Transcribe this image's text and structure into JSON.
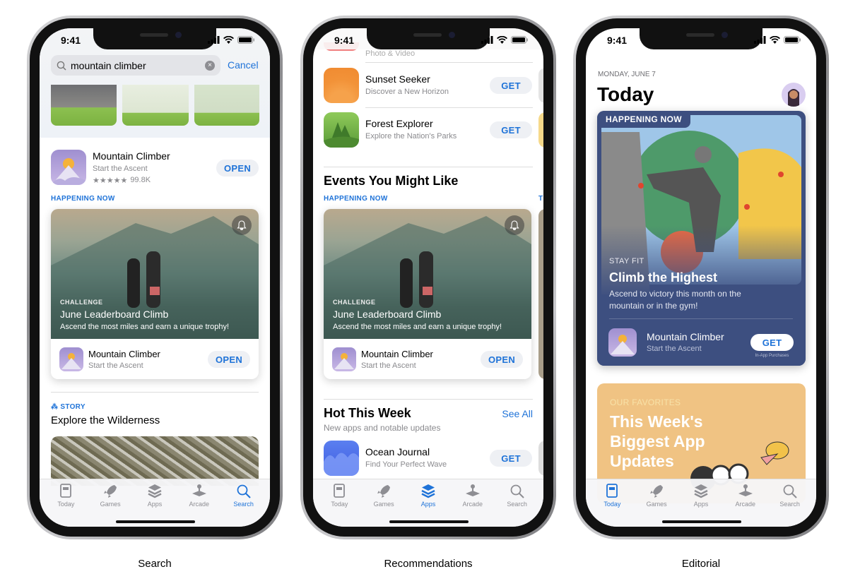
{
  "status_time": "9:41",
  "captions": [
    "Search",
    "Recommendations",
    "Editorial"
  ],
  "colors": {
    "accent": "#1f73d8",
    "editorial_card": "#3d4f80",
    "favorites_card": "#f0c383"
  },
  "tabs": [
    {
      "label": "Today",
      "icon": "today-icon"
    },
    {
      "label": "Games",
      "icon": "rocket-icon"
    },
    {
      "label": "Apps",
      "icon": "layers-icon"
    },
    {
      "label": "Arcade",
      "icon": "joystick-icon"
    },
    {
      "label": "Search",
      "icon": "search-icon"
    }
  ],
  "search_screen": {
    "active_tab": "Search",
    "search_value": "mountain climber",
    "cancel": "Cancel",
    "result": {
      "title": "Mountain Climber",
      "subtitle": "Start the Ascent",
      "rating": 4.5,
      "ratings_count": "99.8K",
      "button": "OPEN"
    },
    "happening_now": "HAPPENING NOW",
    "event": {
      "kicker": "CHALLENGE",
      "title": "June Leaderboard Climb",
      "desc": "Ascend the most miles and earn a unique trophy!",
      "app_title": "Mountain Climber",
      "app_subtitle": "Start the Ascent",
      "button": "OPEN"
    },
    "story": {
      "kicker": "STORY",
      "title": "Explore the Wilderness"
    }
  },
  "recs_screen": {
    "active_tab": "Apps",
    "partial_row": "Photo & Video",
    "apps": [
      {
        "title": "Sunset Seeker",
        "subtitle": "Discover a New Horizon",
        "button": "GET"
      },
      {
        "title": "Forest Explorer",
        "subtitle": "Explore the Nation's Parks",
        "button": "GET"
      }
    ],
    "events_heading": "Events You Might Like",
    "happening_now": "HAPPENING NOW",
    "event": {
      "kicker": "CHALLENGE",
      "title": "June Leaderboard Climb",
      "desc": "Ascend the most miles and earn a unique trophy!",
      "app_title": "Mountain Climber",
      "app_subtitle": "Start the Ascent",
      "button": "OPEN"
    },
    "hot": {
      "title": "Hot This Week",
      "see_all": "See All",
      "subtitle": "New apps and notable updates"
    },
    "hot_app": {
      "title": "Ocean Journal",
      "subtitle": "Find Your Perfect Wave",
      "button": "GET"
    }
  },
  "today_screen": {
    "active_tab": "Today",
    "date": "MONDAY, JUNE 7",
    "title": "Today",
    "card": {
      "badge": "HAPPENING NOW",
      "kicker": "STAY FIT",
      "title": "Climb the Highest",
      "desc": "Ascend to victory this month on the mountain or in the gym!",
      "app_title": "Mountain Climber",
      "app_subtitle": "Start the Ascent",
      "button": "GET",
      "iap": "In-App Purchases"
    },
    "card2": {
      "kicker": "OUR FAVORITES",
      "title": "This Week's Biggest App Updates"
    }
  }
}
